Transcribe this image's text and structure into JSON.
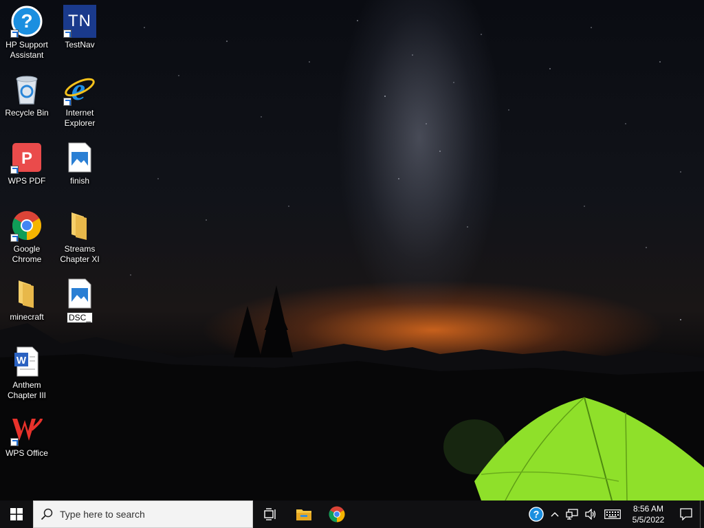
{
  "desktop": {
    "icons": [
      {
        "label": "HP Support Assistant",
        "icon": "help-question-icon"
      },
      {
        "label": "TestNav",
        "icon": "testnav-icon"
      },
      {
        "label": "Recycle Bin",
        "icon": "recycle-bin-icon"
      },
      {
        "label": "Internet Explorer",
        "icon": "internet-explorer-icon"
      },
      {
        "label": "WPS PDF",
        "icon": "wps-pdf-icon"
      },
      {
        "label": "finish",
        "icon": "image-file-icon"
      },
      {
        "label": "Google Chrome",
        "icon": "chrome-icon"
      },
      {
        "label": "Streams Chapter XI",
        "icon": "folder-icon"
      },
      {
        "label": "minecraft",
        "icon": "folder-icon"
      },
      {
        "label": "DSC_",
        "icon": "image-file-icon"
      },
      {
        "label": "Anthem Chapter III",
        "icon": "word-document-icon"
      },
      {
        "label": "WPS Office",
        "icon": "wps-office-icon"
      }
    ],
    "testnav_logo": "TN"
  },
  "taskbar": {
    "search_placeholder": "Type here to search",
    "clock": {
      "time": "8:56 AM",
      "date": "5/5/2022"
    }
  },
  "colors": {
    "taskbar": "#101012",
    "accent_blue": "#1f6fd6",
    "tent_green": "#8fe02a"
  }
}
